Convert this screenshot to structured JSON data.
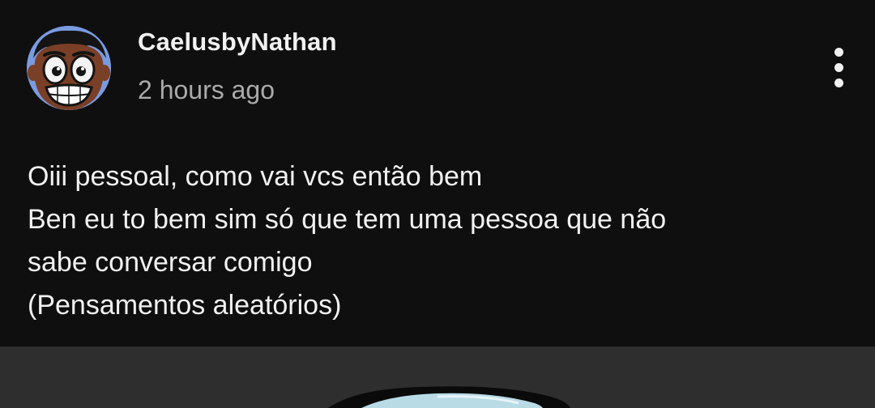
{
  "post": {
    "author": "CaelusbyNathan",
    "timestamp": "2 hours ago",
    "avatar_icon": "avatar-cartoon-face-icon",
    "menu_icon": "more-vertical-icon",
    "body_lines": [
      "Oiii pessoal, como vai vcs então bem",
      "Ben eu to bem sim só que tem uma pessoa que não",
      "sabe conversar comigo",
      "(Pensamentos aleatórios)"
    ]
  },
  "colors": {
    "background": "#0f0f0f",
    "text_primary": "#f1f1f1",
    "text_secondary": "#aaaaaa",
    "attachment_bg": "#2e2e2e"
  }
}
